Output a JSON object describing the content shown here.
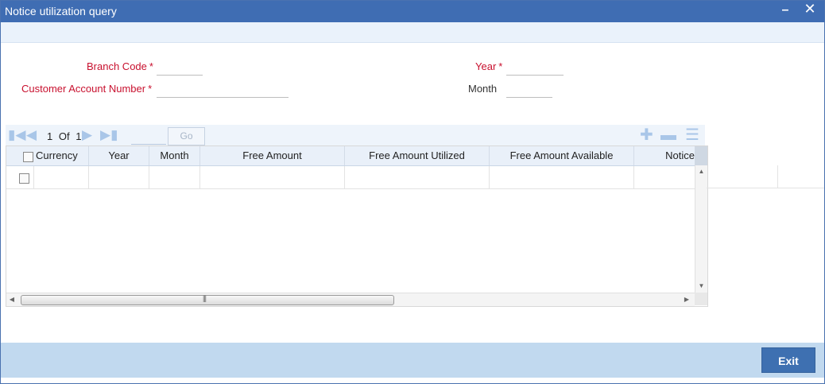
{
  "window": {
    "title": "Notice utilization query",
    "minimize_icon": "minimize-icon",
    "close_icon": "close-icon"
  },
  "form": {
    "branch_code": {
      "label": "Branch Code",
      "required_mark": "*",
      "value": ""
    },
    "customer_account_number": {
      "label": "Customer Account Number",
      "required_mark": "*",
      "value": ""
    },
    "year": {
      "label": "Year",
      "required_mark": "*",
      "value": ""
    },
    "month": {
      "label": "Month",
      "value": ""
    }
  },
  "grid_toolbar": {
    "current_page": "1",
    "of_label": "Of",
    "total_pages": "1",
    "go_label": "Go",
    "icons": [
      "first-page-icon",
      "previous-page-icon",
      "next-page-icon",
      "last-page-icon",
      "add-row-icon",
      "delete-row-icon",
      "single-view-icon"
    ]
  },
  "grid": {
    "columns": [
      "Currency",
      "Year",
      "Month",
      "Free Amount",
      "Free Amount Utilized",
      "Free Amount Available",
      "Notice"
    ],
    "rows": [
      {
        "currency": "",
        "year": "",
        "month": "",
        "free_amount": "",
        "free_amount_utilized": "",
        "free_amount_available": "",
        "notice": ""
      }
    ]
  },
  "footer": {
    "exit_label": "Exit"
  }
}
